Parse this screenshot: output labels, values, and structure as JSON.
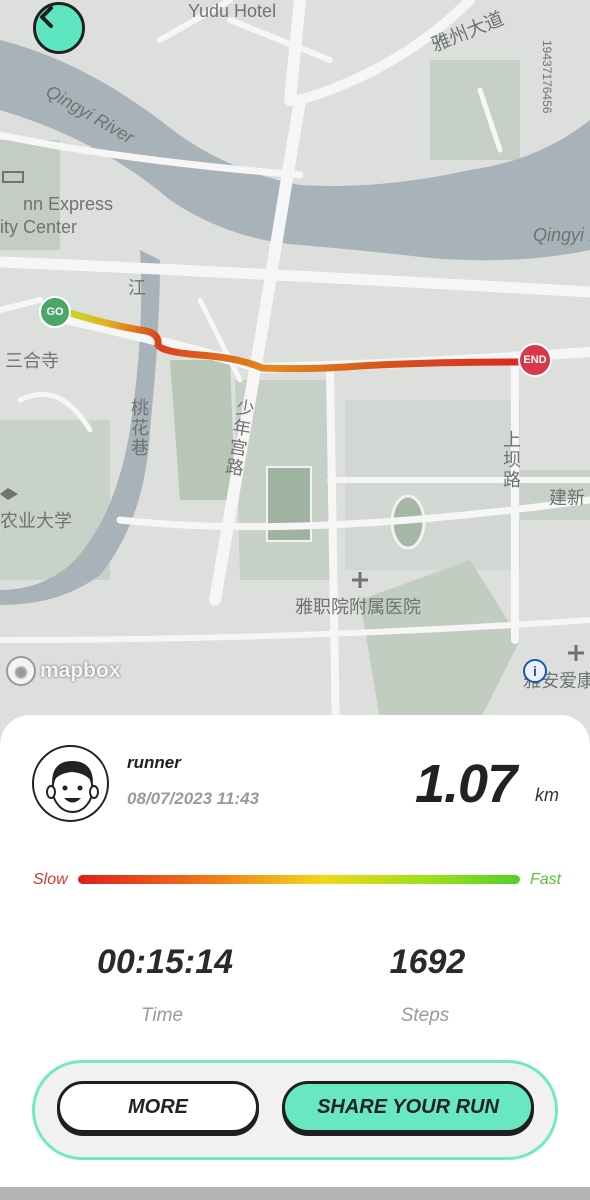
{
  "map": {
    "labels": {
      "yudu_hotel": "Yudu Hotel",
      "qingyi_river_left": "Qingyi River",
      "qingyi_river_right": "Qingyi R",
      "yazhou_avenue": "雅州大道",
      "plate_number": "19437176456",
      "inn_express": "nn Express",
      "city_center": "ity Center",
      "jiang": "江",
      "sanhesi": "三合寺",
      "taohua_alley": "桃花巷",
      "shaonian_gong_road": "少年宫路",
      "shangba_road": "上坝路",
      "jianxin": "建新",
      "agri_university": "农业大学",
      "hospital": "雅职院附属医院",
      "ya_an_aikang": "雅安爱康"
    },
    "markers": {
      "go": "GO",
      "end": "END"
    },
    "attribution": "mapbox",
    "info_symbol": "i",
    "back_icon": "chevron-left-icon"
  },
  "run": {
    "runner_name": "runner",
    "datetime": "08/07/2023 11:43",
    "distance": "1.07",
    "distance_unit": "km",
    "speed_legend": {
      "slow": "Slow",
      "fast": "Fast"
    },
    "time_value": "00:15:14",
    "time_label": "Time",
    "steps_value": "1692",
    "steps_label": "Steps"
  },
  "buttons": {
    "more": "MORE",
    "share": "SHARE YOUR RUN"
  },
  "colors": {
    "accent": "#67e7c2",
    "slow": "#d23b2b",
    "fast": "#5cc22e",
    "start_marker": "#4aa66a",
    "end_marker": "#d9384a",
    "river": "#a7b3b8"
  }
}
